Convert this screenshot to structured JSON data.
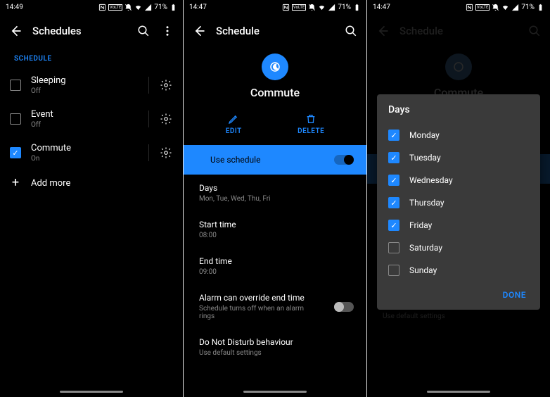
{
  "status": {
    "time1": "14:49",
    "time2": "14:47",
    "time3": "14:47",
    "battery": "71%"
  },
  "screen1": {
    "title": "Schedules",
    "section": "SCHEDULE",
    "items": [
      {
        "title": "Sleeping",
        "sub": "Off",
        "checked": false
      },
      {
        "title": "Event",
        "sub": "Off",
        "checked": false
      },
      {
        "title": "Commute",
        "sub": "On",
        "checked": true
      }
    ],
    "addMore": "Add more"
  },
  "screen2": {
    "title": "Schedule",
    "name": "Commute",
    "editLabel": "EDIT",
    "deleteLabel": "DELETE",
    "useSchedule": "Use schedule",
    "settings": {
      "daysTitle": "Days",
      "daysValue": "Mon, Tue, Wed, Thu, Fri",
      "startTitle": "Start time",
      "startValue": "08:00",
      "endTitle": "End time",
      "endValue": "09:00",
      "alarmTitle": "Alarm can override end time",
      "alarmSub": "Schedule turns off when an alarm rings",
      "dndTitle": "Do Not Disturb behaviour",
      "dndSub": "Use default settings"
    }
  },
  "screen3": {
    "title": "Schedule",
    "name": "Commute",
    "dialogTitle": "Days",
    "days": [
      {
        "label": "Monday",
        "checked": true
      },
      {
        "label": "Tuesday",
        "checked": true
      },
      {
        "label": "Wednesday",
        "checked": true
      },
      {
        "label": "Thursday",
        "checked": true
      },
      {
        "label": "Friday",
        "checked": true
      },
      {
        "label": "Saturday",
        "checked": false
      },
      {
        "label": "Sunday",
        "checked": false
      }
    ],
    "done": "DONE",
    "dndSub": "Use default settings"
  }
}
